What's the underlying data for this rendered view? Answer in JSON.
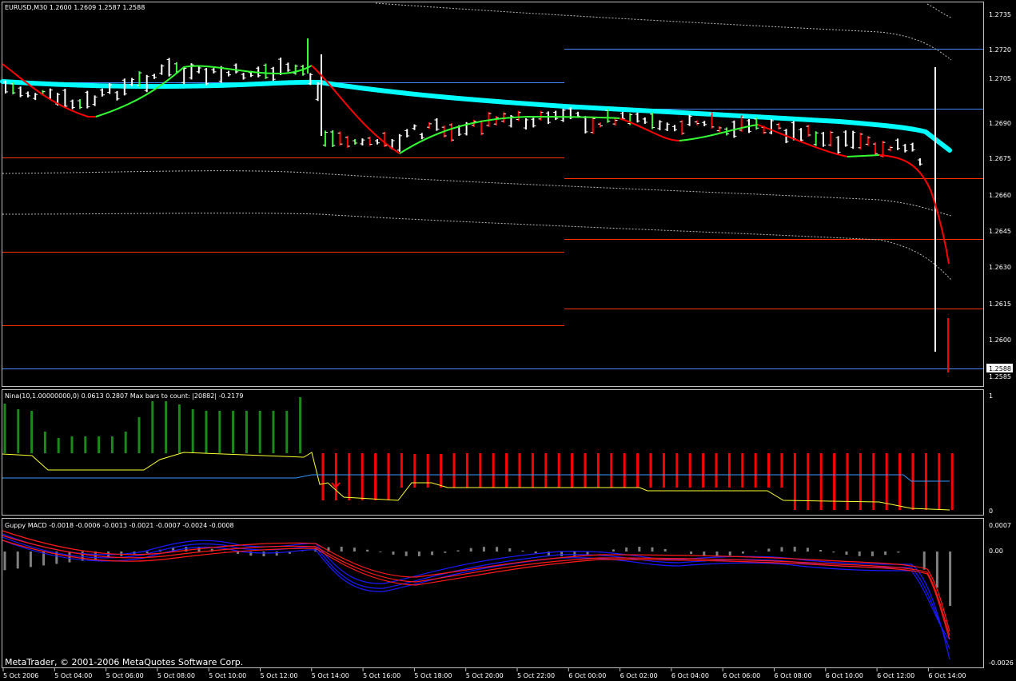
{
  "window": {
    "symbol_header": "EURUSD,M30  1.2600 1.2609 1.2587 1.2588",
    "copyright": "MetaTrader, © 2001-2006 MetaQuotes Software Corp."
  },
  "price_panel": {
    "price_scale": [
      "1.2735",
      "1.2720",
      "1.2705",
      "1.2690",
      "1.2675",
      "1.2660",
      "1.2645",
      "1.2630",
      "1.2615",
      "1.2600",
      "1.2585"
    ],
    "current_price": "1.2588"
  },
  "nina_panel": {
    "header": "Nina(10,1.00000000,0) 0.0613 0.2807  Max bars to count: |20882|  -0.2179",
    "scale": [
      "1",
      "0"
    ]
  },
  "macd_panel": {
    "header": "Guppy MACD -0.0018 -0.0006 -0.0013 -0.0021 -0.0007 -0.0024 -0.0008",
    "scale": [
      "0.0007",
      "0.00",
      "-0.0026"
    ]
  },
  "time_axis": [
    "5 Oct 2006",
    "5 Oct 04:00",
    "5 Oct 06:00",
    "5 Oct 08:00",
    "5 Oct 10:00",
    "5 Oct 12:00",
    "5 Oct 14:00",
    "5 Oct 16:00",
    "5 Oct 18:00",
    "5 Oct 20:00",
    "5 Oct 22:00",
    "6 Oct 00:00",
    "6 Oct 02:00",
    "6 Oct 04:00",
    "6 Oct 06:00",
    "6 Oct 08:00",
    "6 Oct 10:00",
    "6 Oct 12:00",
    "6 Oct 14:00"
  ],
  "colors": {
    "background": "#000000",
    "bull_candle": "#ffffff",
    "bear_candle": "#ffffff",
    "ma_thick": "#00ffff",
    "ma_up": "#33ff33",
    "ma_down": "#ff0000",
    "level_red": "#ff3300",
    "level_blue": "#4488ff",
    "hist_green": "#1a8a1a",
    "hist_red": "#ff0000",
    "macd_blue": "#1a1aff",
    "macd_red": "#ff1a1a",
    "macd_hist": "#808080"
  },
  "icons": [
    "down-arrow-icon"
  ]
}
